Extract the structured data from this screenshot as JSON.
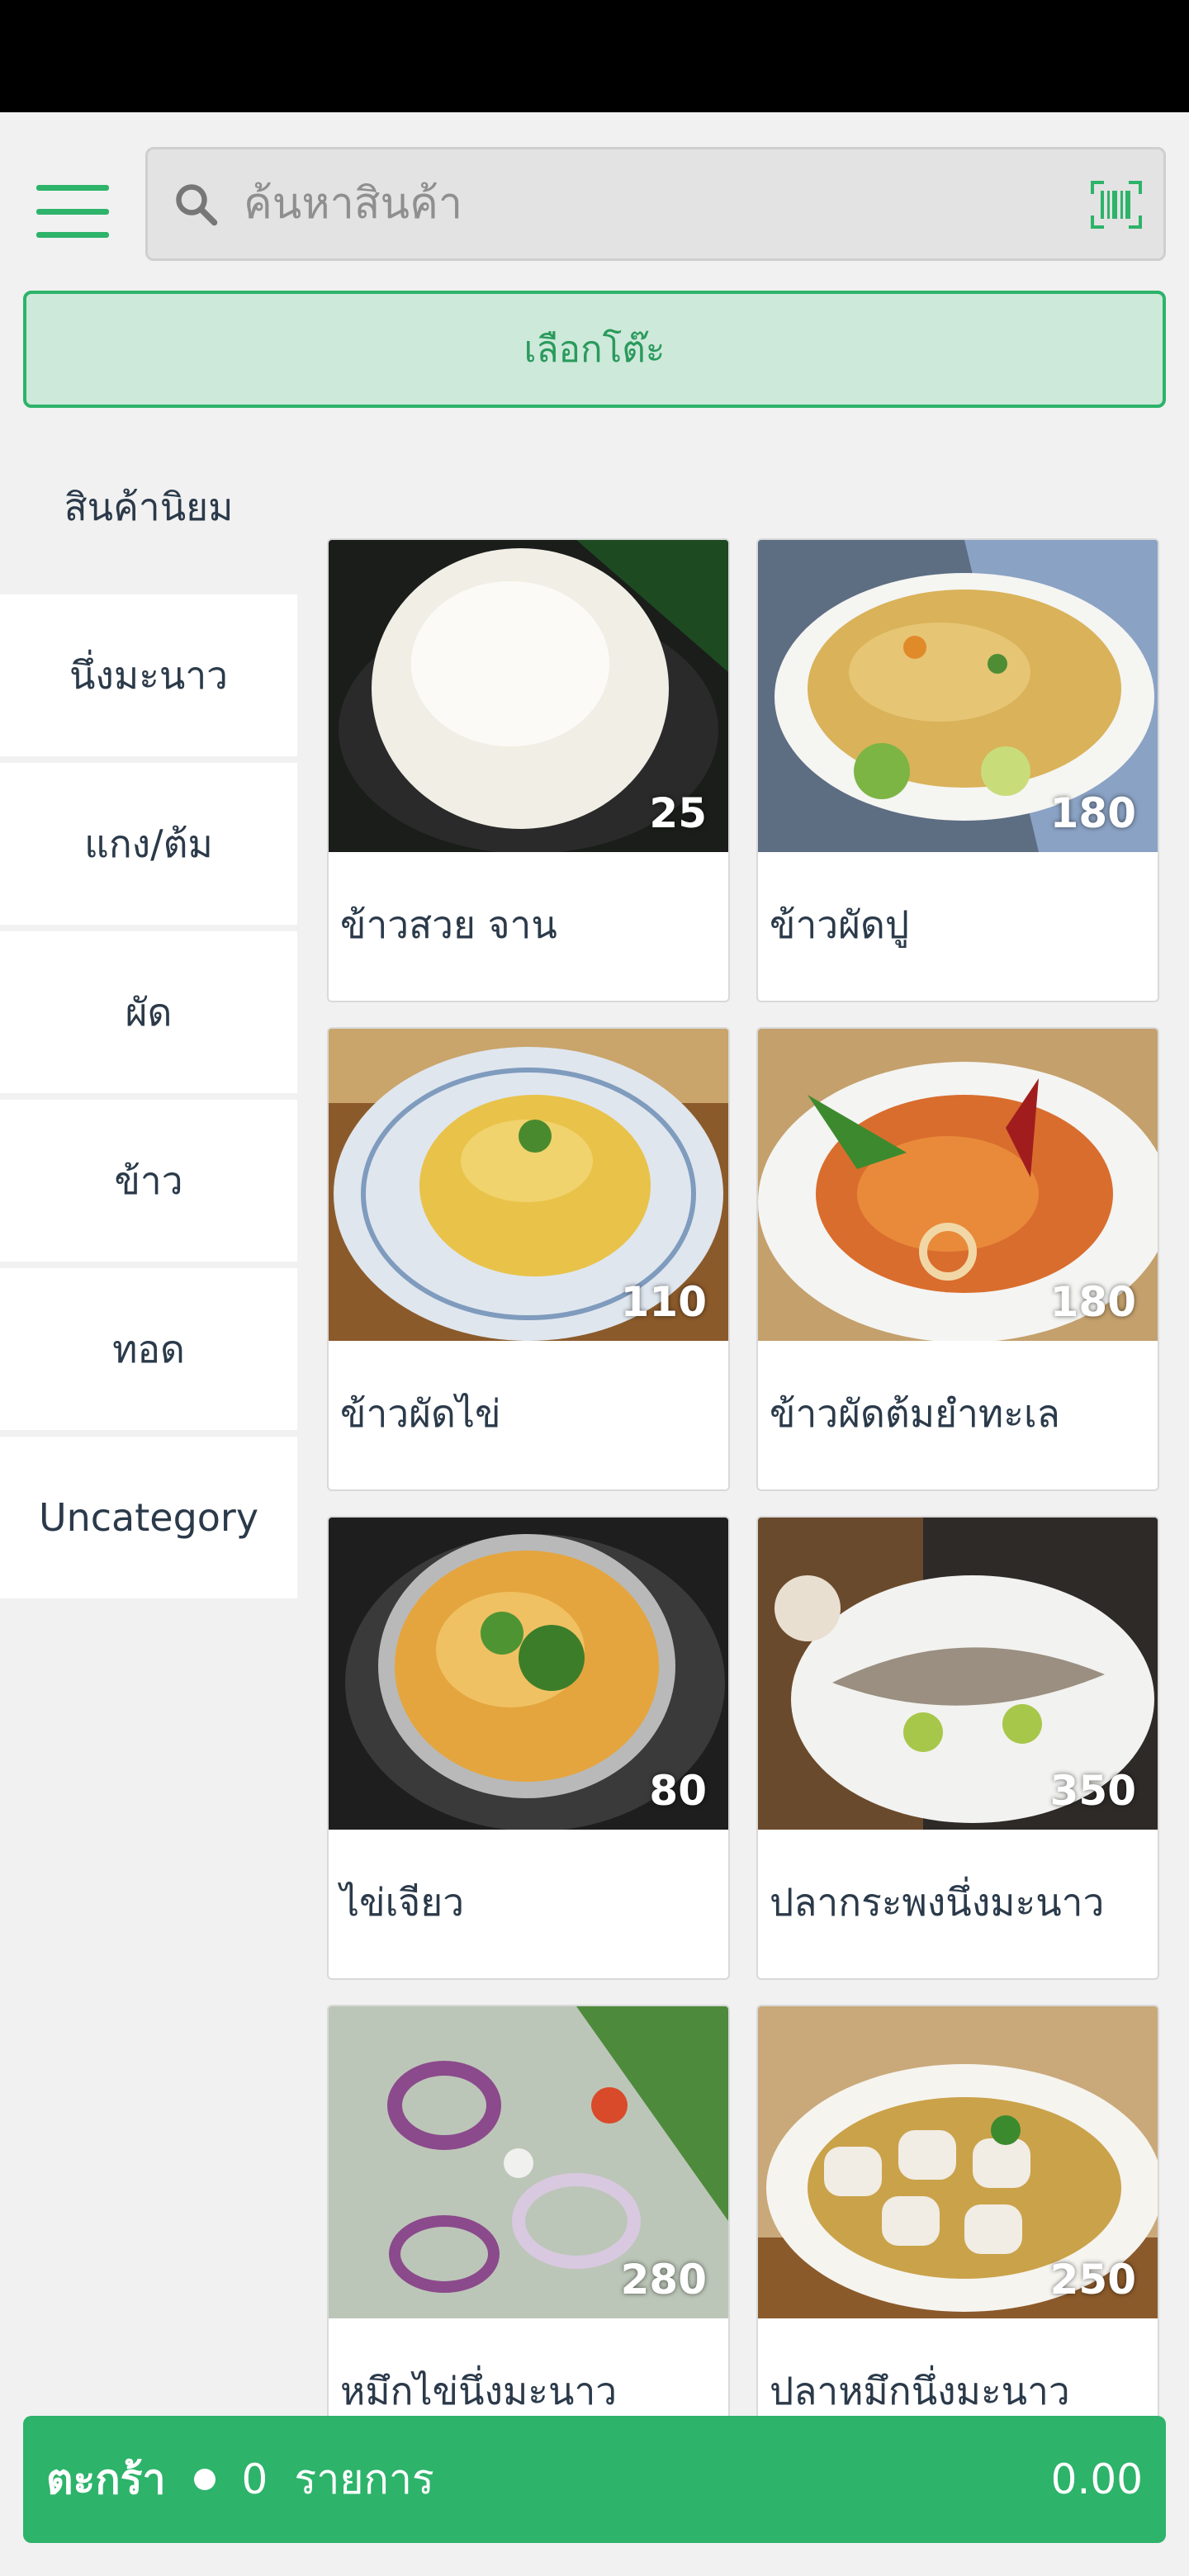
{
  "search": {
    "placeholder": "ค้นหาสินค้า"
  },
  "select_table_label": "เลือกโต๊ะ",
  "categories": [
    "สินค้านิยม",
    "นึ่งมะนาว",
    "แกง/ต้ม",
    "ผัด",
    "ข้าว",
    "ทอด",
    "Uncategory"
  ],
  "products": [
    {
      "name": "ข้าวสวย จาน",
      "price": "25"
    },
    {
      "name": "ข้าวผัดปู",
      "price": "180"
    },
    {
      "name": "ข้าวผัดไข่",
      "price": "110"
    },
    {
      "name": "ข้าวผัดต้มยำทะเล",
      "price": "180"
    },
    {
      "name": "ไข่เจียว",
      "price": "80"
    },
    {
      "name": "ปลากระพงนึ่งมะนาว",
      "price": "350"
    },
    {
      "name": "หมึกไข่นึ่งมะนาว",
      "price": "280"
    },
    {
      "name": "ปลาหมึกนึ่งมะนาว",
      "price": "250"
    }
  ],
  "cart": {
    "label": "ตะกร้า",
    "count": "0",
    "unit": "รายการ",
    "total": "0.00"
  },
  "colors": {
    "accent": "#2db36a",
    "accent_light": "#cde9da",
    "text": "#2b3a4a",
    "background": "#f1f1f1"
  },
  "icons": {
    "menu": "hamburger-icon",
    "search": "search-icon",
    "barcode": "barcode-icon"
  }
}
